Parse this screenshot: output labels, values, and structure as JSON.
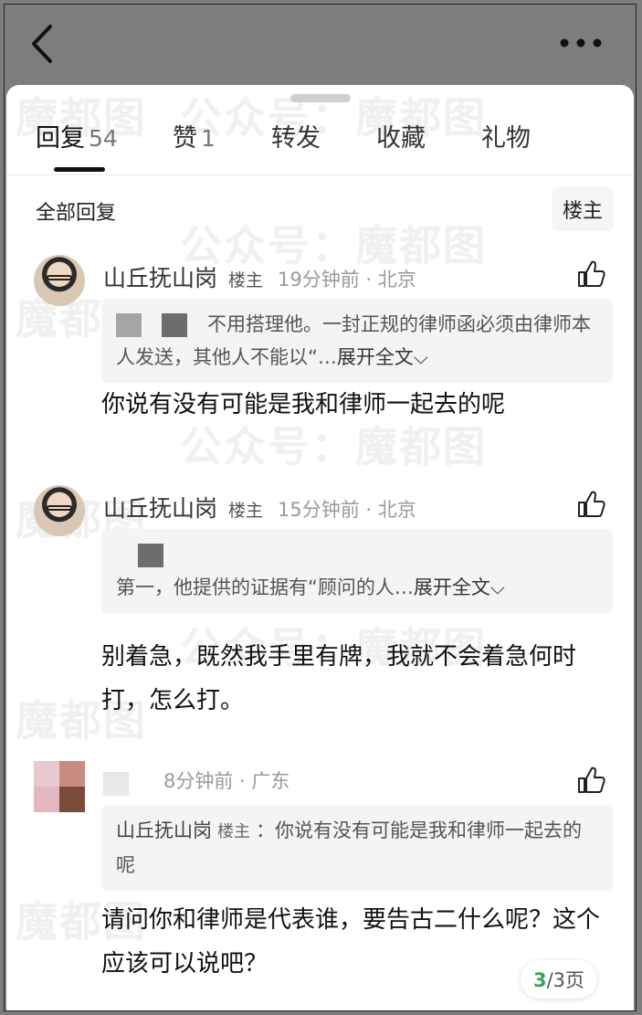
{
  "header": {
    "back_icon": "chevron-left-icon",
    "more_icon": "more-horizontal-icon"
  },
  "tabs": [
    {
      "label": "回复",
      "count": "54"
    },
    {
      "label": "赞",
      "count": "1"
    },
    {
      "label": "转发",
      "count": ""
    },
    {
      "label": "收藏",
      "count": ""
    },
    {
      "label": "礼物",
      "count": ""
    }
  ],
  "section": {
    "title": "全部回复",
    "filter_label": "楼主"
  },
  "comments": [
    {
      "username": "山丘抚山岗",
      "badge": "楼主",
      "time": "19分钟前 · 北京",
      "quote_text": "不用搭理他。一封正规的律师函必须由律师本人发送，其他人不能以“…",
      "expand": "展开全文",
      "body": "你说有没有可能是我和律师一起去的呢"
    },
    {
      "username": "山丘抚山岗",
      "badge": "楼主",
      "time": "15分钟前 · 北京",
      "quote_text": "第一，他提供的证据有“顾问的人…",
      "expand": "展开全文",
      "body": "别着急，既然我手里有牌，我就不会着急何时打，怎么打。"
    },
    {
      "username": "",
      "badge": "",
      "time": "8分钟前 · 广东",
      "quote_user": "山丘抚山岗",
      "quote_badge": "楼主",
      "quote_text": "：你说有没有可能是我和律师一起去的呢",
      "body": "请问你和律师是代表谁，要告古二什么呢？这个应该可以说吧？"
    }
  ],
  "pager": {
    "current": "3",
    "total": "/3页"
  },
  "watermark": {
    "text1": "魔都图",
    "text2": "公众号：魔都图"
  },
  "colors": {
    "accent_green": "#3aa35a",
    "sheet_bg": "#ffffff",
    "top_bg": "#7d7d7d"
  }
}
